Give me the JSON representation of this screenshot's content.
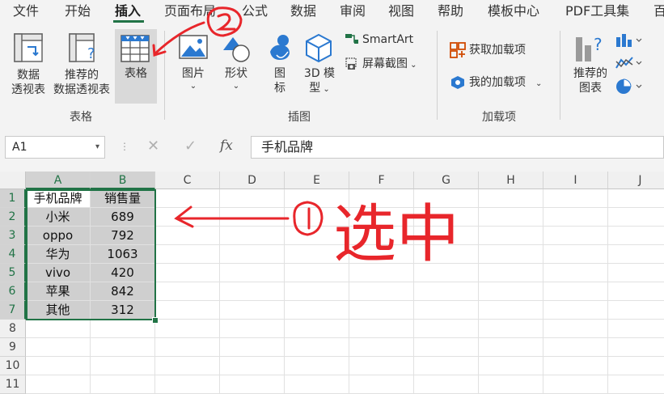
{
  "menu": {
    "tabs": [
      "文件",
      "开始",
      "插入",
      "页面布局",
      "公式",
      "数据",
      "审阅",
      "视图",
      "帮助",
      "模板中心",
      "PDF工具集",
      "百"
    ],
    "active_tab": "插入"
  },
  "ribbon": {
    "tables_group": {
      "label": "表格",
      "pivot_table": [
        "数据",
        "透视表"
      ],
      "recommended_pivot": [
        "推荐的",
        "数据透视表"
      ],
      "table": "表格"
    },
    "illustrations_group": {
      "label": "插图",
      "pictures": "图片",
      "shapes": "形状",
      "icons": [
        "图",
        "标"
      ],
      "models_3d": [
        "3D 模",
        "型"
      ],
      "smartart": "SmartArt",
      "screenshot": "屏幕截图"
    },
    "addins_group": {
      "label": "加载项",
      "get_addins": "获取加载项",
      "my_addins": "我的加载项"
    },
    "charts_group": {
      "recommended_charts": [
        "推荐的",
        "图表"
      ]
    },
    "colors": {
      "accent": "#217346",
      "orange": "#d04a02",
      "blue": "#2b79d0",
      "annotation": "#e8262b"
    }
  },
  "formula_bar": {
    "name_box": "A1",
    "fx_label": "fx",
    "formula": "手机品牌"
  },
  "sheet": {
    "columns": [
      "A",
      "B",
      "C",
      "D",
      "E",
      "F",
      "G",
      "H",
      "I",
      "J"
    ],
    "rows": [
      "1",
      "2",
      "3",
      "4",
      "5",
      "6",
      "7",
      "8",
      "9",
      "10",
      "11"
    ],
    "header_row": [
      "手机品牌",
      "销售量"
    ],
    "data_rows": [
      [
        "小米",
        "689"
      ],
      [
        "oppo",
        "792"
      ],
      [
        "华为",
        "1063"
      ],
      [
        "vivo",
        "420"
      ],
      [
        "苹果",
        "842"
      ],
      [
        "其他",
        "312"
      ]
    ]
  },
  "annotations": {
    "step1_text": "选中"
  }
}
